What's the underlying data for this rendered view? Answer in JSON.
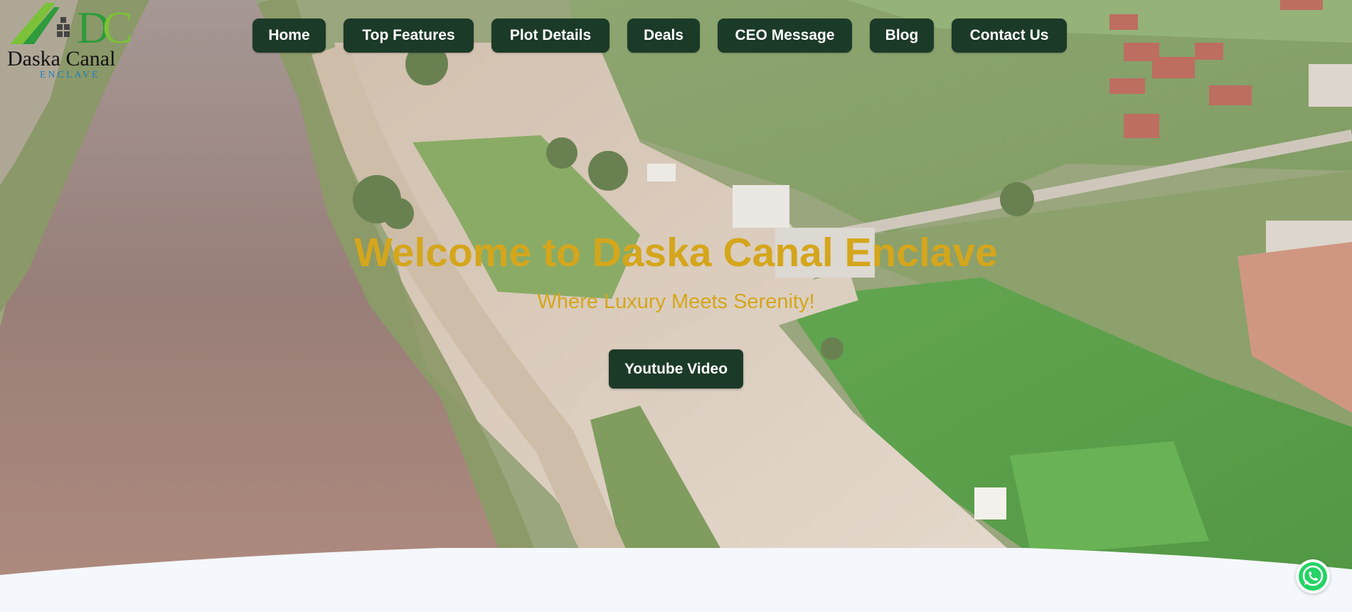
{
  "brand": {
    "name": "Daska Canal",
    "sub": "ENCLAVE",
    "colors": {
      "green": "#2e9b3c",
      "lime": "#7cc13a",
      "blue": "#1f7fc1"
    }
  },
  "nav": {
    "items": [
      {
        "label": "Home"
      },
      {
        "label": "Top Features"
      },
      {
        "label": "Plot Details"
      },
      {
        "label": "Deals"
      },
      {
        "label": "CEO Message"
      },
      {
        "label": "Blog"
      },
      {
        "label": "Contact Us"
      }
    ],
    "bg_color": "#1c3a28"
  },
  "hero": {
    "title": "Welcome to Daska Canal Enclave",
    "subtitle": "Where Luxury Meets Serenity!",
    "text_color": "#d4a61c",
    "button_label": "Youtube Video"
  },
  "floating": {
    "whatsapp_icon": "whatsapp-icon",
    "whatsapp_color": "#25d366"
  }
}
